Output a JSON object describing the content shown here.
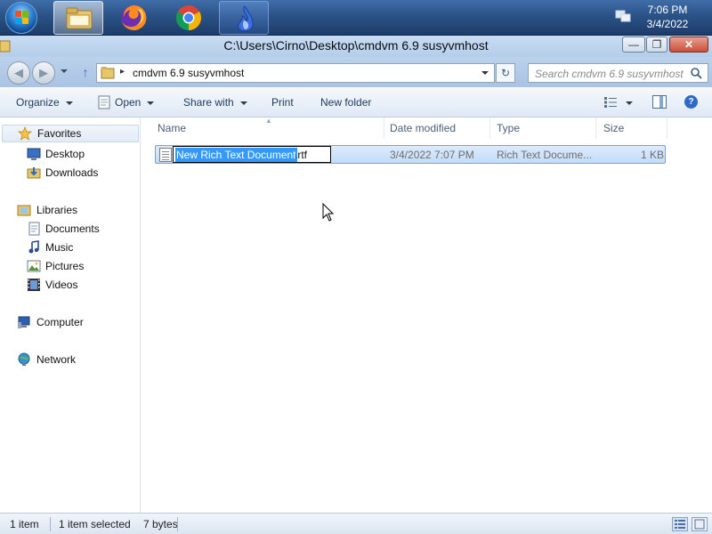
{
  "colors": {
    "taskbar": "#2b5287",
    "titlebar": "#c8ddf3",
    "selection": "#3399ff",
    "row_selected": "#cde2fb",
    "toolbar_text": "#1e395b"
  },
  "taskbar": {
    "start_icon": "windows-orb-icon",
    "apps": [
      {
        "name": "file-explorer",
        "icon": "folder-explorer-icon"
      },
      {
        "name": "firefox",
        "icon": "firefox-icon"
      },
      {
        "name": "chrome",
        "icon": "chrome-icon"
      },
      {
        "name": "app",
        "icon": "flame-app-icon"
      }
    ],
    "tray_icon": "network-tray-icon",
    "clock": {
      "time": "7:06 PM",
      "date": "3/4/2022"
    }
  },
  "window": {
    "title": "C:\\Users\\Cirno\\Desktop\\cmdvm 6.9 susyvmhost",
    "minimize_label": "—",
    "maximize_label": "❐",
    "close_label": "✕"
  },
  "address": {
    "back_label": "◀",
    "forward_label": "▶",
    "up_label": "↑",
    "chevron": "▸",
    "path": "cmdvm 6.9 susyvmhost",
    "refresh_label": "↻",
    "search_placeholder": "Search cmdvm 6.9 susyvmhost"
  },
  "toolbar": {
    "organize": "Organize",
    "open": "Open",
    "share_with": "Share with",
    "print": "Print",
    "new_folder": "New folder",
    "help_label": "?"
  },
  "nav": {
    "favorites": "Favorites",
    "desktop": "Desktop",
    "downloads": "Downloads",
    "libraries": "Libraries",
    "documents": "Documents",
    "music": "Music",
    "pictures": "Pictures",
    "videos": "Videos",
    "computer": "Computer",
    "network": "Network"
  },
  "columns": {
    "name": "Name",
    "date_modified": "Date modified",
    "type": "Type",
    "size": "Size"
  },
  "file": {
    "rename_selected": "New Rich Text Document",
    "rename_rest": ".rtf",
    "date_modified": "3/4/2022 7:07 PM",
    "type": "Rich Text Docume...",
    "size": "1 KB"
  },
  "status": {
    "count": "1 item",
    "selected": "1 item selected",
    "bytes": "7 bytes"
  }
}
